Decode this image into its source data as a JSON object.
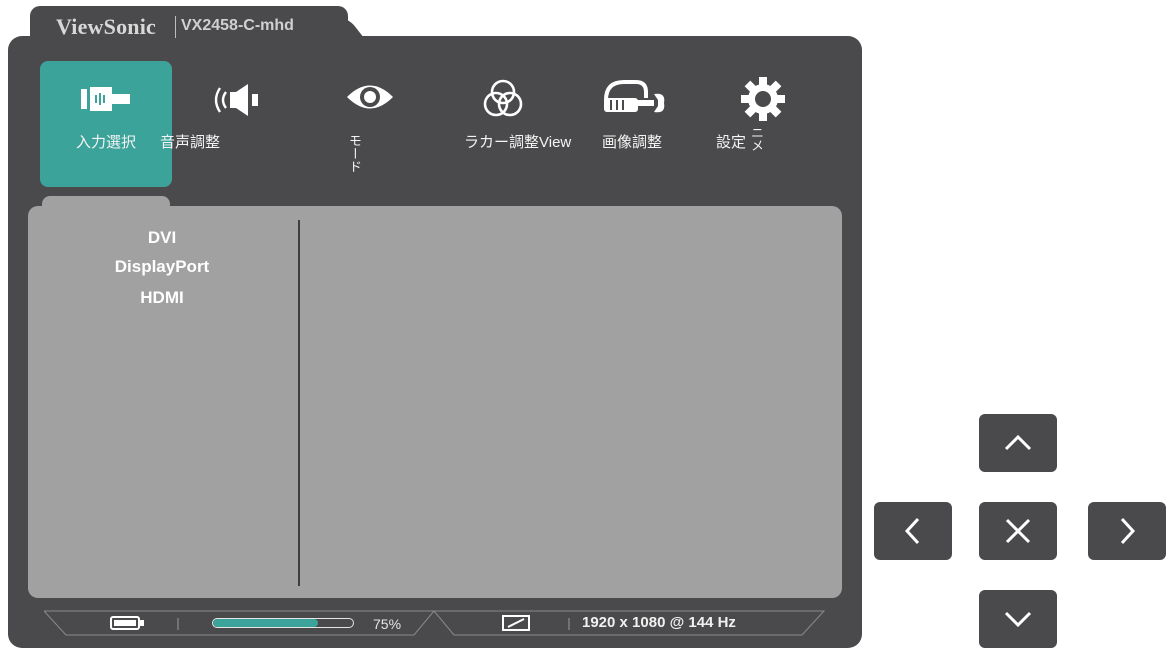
{
  "header": {
    "brand": "ViewSonic",
    "model": "VX2458-C-mhd"
  },
  "tabs": [
    {
      "label": "入力選択",
      "icon": "input-icon",
      "active": true
    },
    {
      "label": "音声調整",
      "icon": "speaker-icon"
    },
    {
      "label": "モード",
      "icon": "eye-icon"
    },
    {
      "label": "ラカー調整View",
      "icon": "color-circles-icon"
    },
    {
      "label": "画像調整",
      "icon": "wrench-hand-icon"
    },
    {
      "label": "設定",
      "label_vertical": "ニメ",
      "icon": "gear-icon"
    }
  ],
  "submenu": {
    "items": [
      "DVI",
      "DisplayPort",
      "HDMI"
    ]
  },
  "status": {
    "battery_icon": "battery-icon",
    "progress": 0.75,
    "progress_label": "75%",
    "aspect_icon": "aspect-ratio-icon",
    "resolution": "1920 x 1080 @ 144 Hz"
  },
  "colors": {
    "panel": "#4a4a4c",
    "content": "#a2a1a2",
    "accent": "#3ba39a"
  },
  "nav": [
    "up-arrow-icon",
    "left-arrow-icon",
    "close-icon",
    "right-arrow-icon",
    "down-arrow-icon"
  ]
}
